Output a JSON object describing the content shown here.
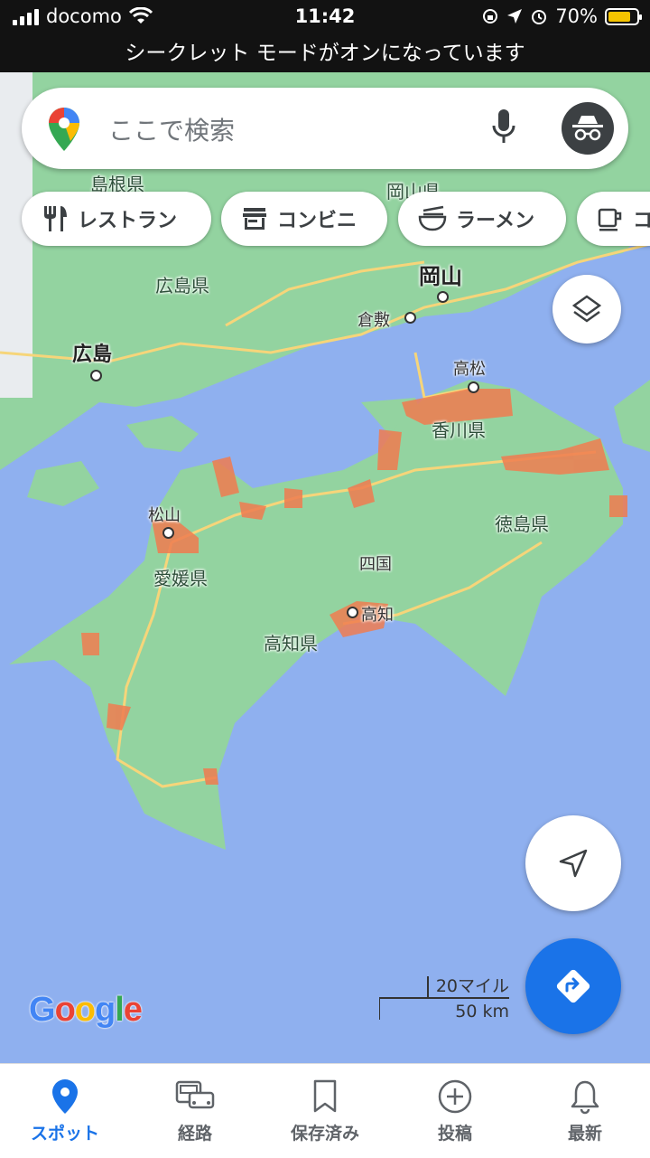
{
  "status_bar": {
    "carrier": "docomo",
    "time": "11:42",
    "battery": "70%"
  },
  "incognito_banner": "シークレット モードがオンになっています",
  "search": {
    "placeholder": "ここで検索"
  },
  "chips": [
    {
      "label": "レストラン",
      "icon": "fork-knife-icon"
    },
    {
      "label": "コンビニ",
      "icon": "store-icon"
    },
    {
      "label": "ラーメン",
      "icon": "ramen-bowl-icon"
    },
    {
      "label": "コ",
      "icon": "coffee-icon"
    }
  ],
  "map_labels": {
    "shimane": "島根県",
    "okayama_pref": "岡山県",
    "hiroshima_pref": "広島県",
    "hiroshima": "広島",
    "okayama": "岡山",
    "kurashiki": "倉敷",
    "takamatsu": "高松",
    "kagawa": "香川県",
    "matsuyama": "松山",
    "ehime": "愛媛県",
    "shikoku": "四国",
    "tokushima": "徳島県",
    "kochi": "高知",
    "kochi_pref": "高知県"
  },
  "scale": {
    "miles": "20マイル",
    "km": "50 km"
  },
  "google_logo": "Google",
  "nav": [
    {
      "label": "スポット",
      "icon": "location-pin-icon",
      "active": true
    },
    {
      "label": "経路",
      "icon": "car-icon",
      "active": false
    },
    {
      "label": "保存済み",
      "icon": "bookmark-icon",
      "active": false
    },
    {
      "label": "投稿",
      "icon": "plus-circle-icon",
      "active": false
    },
    {
      "label": "最新",
      "icon": "bell-icon",
      "active": false
    }
  ],
  "colors": {
    "accent": "#1a73e8",
    "water": "#8fb0ef",
    "land": "#93d3a0",
    "traffic": "#f07c50"
  }
}
